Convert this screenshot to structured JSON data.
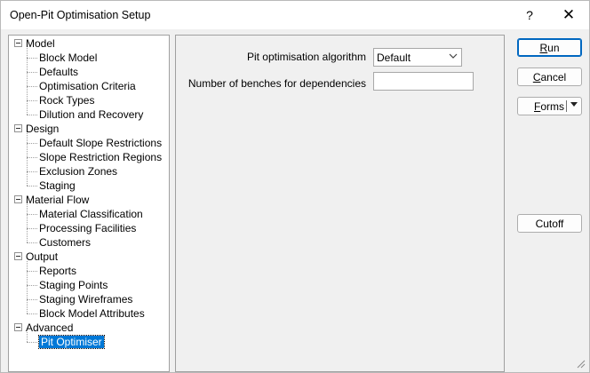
{
  "window": {
    "title": "Open-Pit Optimisation Setup",
    "help_glyph": "?",
    "close_glyph": "✕"
  },
  "tree": {
    "groups": [
      {
        "label": "Model",
        "children": [
          "Block Model",
          "Defaults",
          "Optimisation Criteria",
          "Rock Types",
          "Dilution and Recovery"
        ]
      },
      {
        "label": "Design",
        "children": [
          "Default Slope Restrictions",
          "Slope Restriction Regions",
          "Exclusion Zones",
          "Staging"
        ]
      },
      {
        "label": "Material Flow",
        "children": [
          "Material Classification",
          "Processing Facilities",
          "Customers"
        ]
      },
      {
        "label": "Output",
        "children": [
          "Reports",
          "Staging Points",
          "Staging Wireframes",
          "Block Model Attributes"
        ]
      },
      {
        "label": "Advanced",
        "children": [
          "Pit Optimiser"
        ]
      }
    ],
    "selected": "Pit Optimiser"
  },
  "form": {
    "algorithm_label": "Pit optimisation algorithm",
    "algorithm_value": "Default",
    "benches_label": "Number of benches for dependencies",
    "benches_value": ""
  },
  "buttons": {
    "run_label": "Run",
    "run_accel": "R",
    "run_rest": "un",
    "cancel_accel": "C",
    "cancel_rest": "ancel",
    "forms_accel": "F",
    "forms_rest": "orms",
    "cutoff_label": "Cutoff"
  },
  "icons": {
    "expander": "minus-box-icon",
    "dropdown": "chevron-down-icon",
    "split": "triangle-down-icon",
    "grip": "resize-grip-icon"
  }
}
